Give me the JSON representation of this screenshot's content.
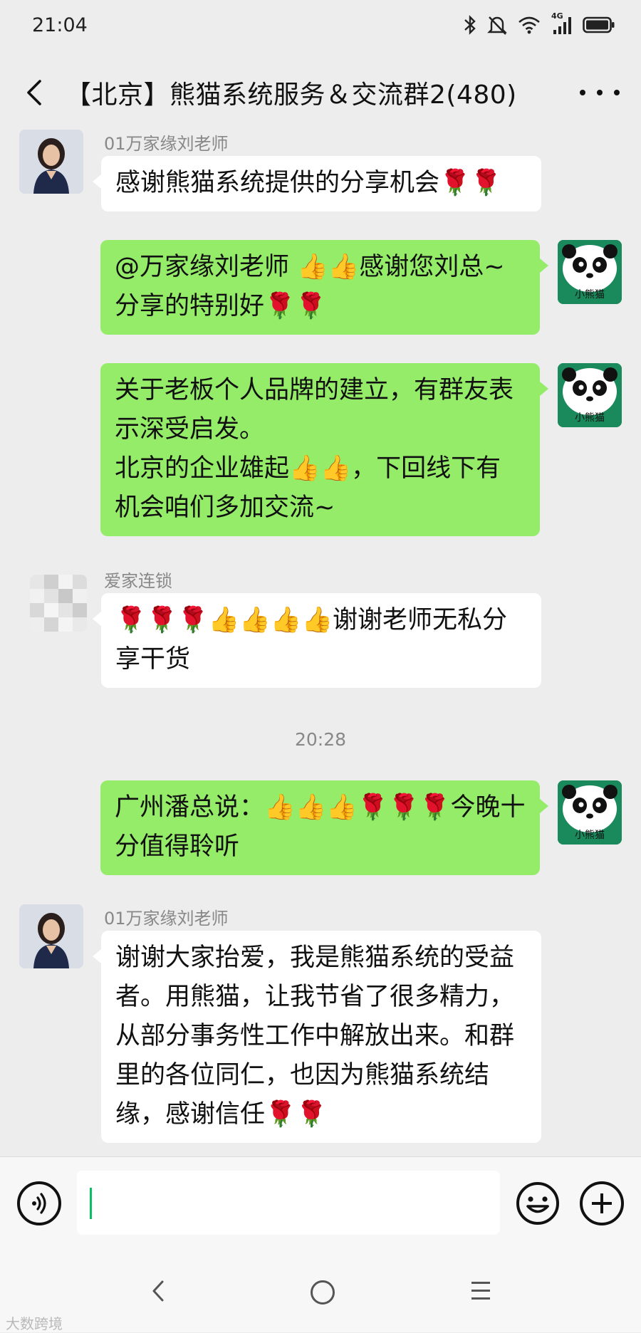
{
  "status_bar": {
    "time": "21:04",
    "network_label": "4G"
  },
  "header": {
    "title": "【北京】熊猫系统服务＆交流群2(480)"
  },
  "panda_avatar_label": "小熊猫",
  "messages": [
    {
      "sender": "01万家缘刘老师",
      "text": "感谢熊猫系统提供的分享机会🌹🌹"
    },
    {
      "text": "@万家缘刘老师 👍👍感谢您刘总~分享的特别好🌹🌹"
    },
    {
      "text": "关于老板个人品牌的建立，有群友表示深受启发。\n北京的企业雄起👍👍，下回线下有机会咱们多加交流~"
    },
    {
      "sender": "爱家连锁",
      "text": "🌹🌹🌹👍👍👍👍谢谢老师无私分享干货"
    },
    {
      "text": "广州潘总说：👍👍👍🌹🌹🌹今晚十分值得聆听"
    },
    {
      "sender": "01万家缘刘老师",
      "text": "谢谢大家抬爱，我是熊猫系统的受益者。用熊猫，让我节省了很多精力，从部分事务性工作中解放出来。和群里的各位同仁，也因为熊猫系统结缘，感谢信任🌹🌹"
    }
  ],
  "timestamp": "20:28",
  "input": {
    "value": ""
  },
  "watermark": "大数跨境",
  "colors": {
    "background": "#ededed",
    "outgoing_bubble": "#95ec69",
    "incoming_bubble": "#ffffff",
    "cursor": "#07c160"
  }
}
